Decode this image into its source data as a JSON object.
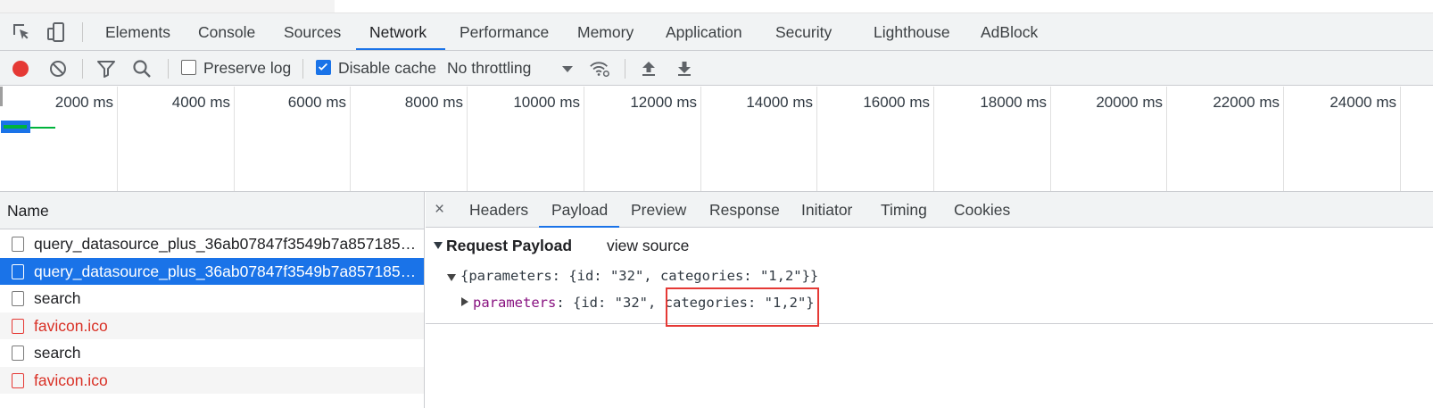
{
  "main_tabs": [
    {
      "label": "Elements"
    },
    {
      "label": "Console"
    },
    {
      "label": "Sources"
    },
    {
      "label": "Network",
      "active": true
    },
    {
      "label": "Performance"
    },
    {
      "label": "Memory"
    },
    {
      "label": "Application"
    },
    {
      "label": "Security"
    },
    {
      "label": "Lighthouse"
    },
    {
      "label": "AdBlock"
    }
  ],
  "toolbar": {
    "preserve_log_label": "Preserve log",
    "preserve_log_checked": false,
    "disable_cache_label": "Disable cache",
    "disable_cache_checked": true,
    "throttling_value": "No throttling",
    "accent_color": "#1a73e8",
    "record_color": "#e53935"
  },
  "overview": {
    "ticks": [
      "2000 ms",
      "4000 ms",
      "6000 ms",
      "8000 ms",
      "10000 ms",
      "12000 ms",
      "14000 ms",
      "16000 ms",
      "18000 ms",
      "20000 ms",
      "22000 ms",
      "24000 ms"
    ]
  },
  "request_list": {
    "header": "Name",
    "rows": [
      {
        "name": "query_datasource_plus_36ab07847f3549b7a857185b...",
        "state": "normal"
      },
      {
        "name": "query_datasource_plus_36ab07847f3549b7a857185b...",
        "state": "selected"
      },
      {
        "name": "search",
        "state": "normal"
      },
      {
        "name": "favicon.ico",
        "state": "error"
      },
      {
        "name": "search",
        "state": "normal"
      },
      {
        "name": "favicon.ico",
        "state": "error"
      }
    ]
  },
  "details": {
    "close_glyph": "×",
    "tabs": [
      {
        "label": "Headers"
      },
      {
        "label": "Payload",
        "active": true
      },
      {
        "label": "Preview"
      },
      {
        "label": "Response"
      },
      {
        "label": "Initiator"
      },
      {
        "label": "Timing"
      },
      {
        "label": "Cookies"
      }
    ],
    "section_title": "Request Payload",
    "view_source_label": "view source",
    "payload_summary": "{parameters: {id: \"32\", categories: \"1,2\"}}",
    "param_key": "parameters",
    "param_value_prefix": ": {id: \"32\", ",
    "param_value_highlight": "categories: \"1,2\"",
    "param_value_suffix": "}"
  }
}
